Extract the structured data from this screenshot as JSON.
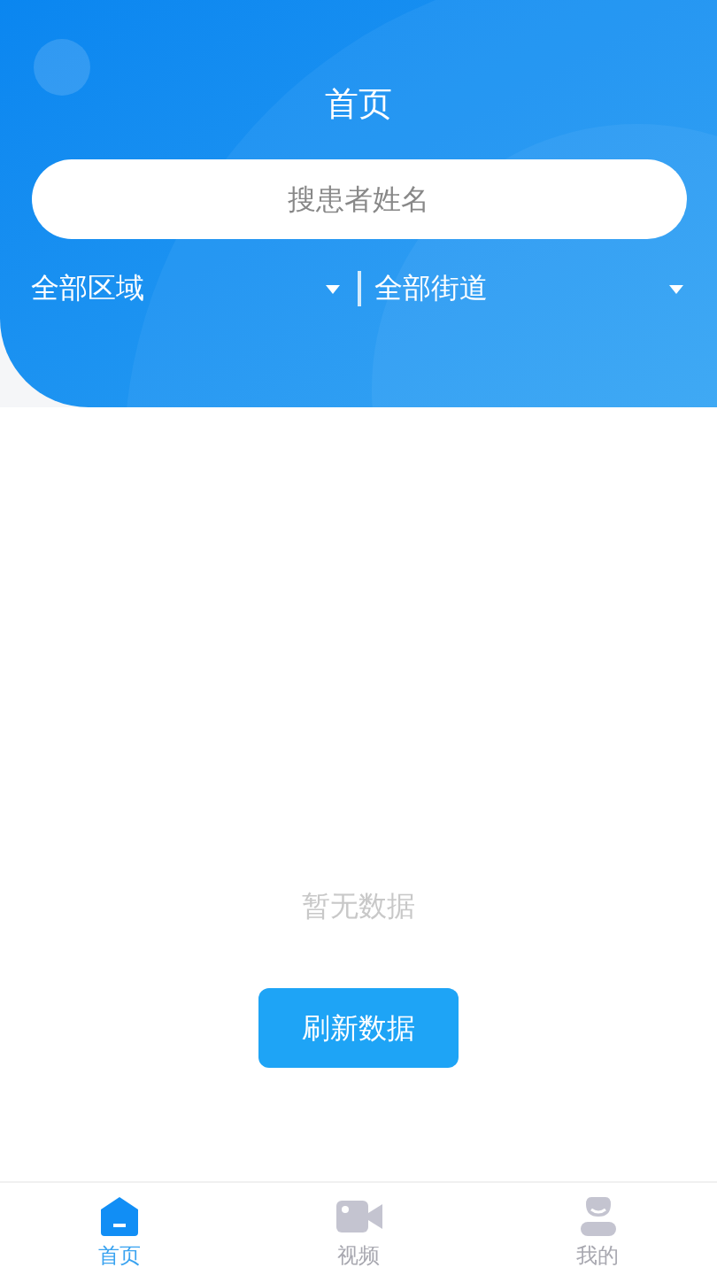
{
  "header": {
    "title": "首页",
    "search": {
      "placeholder": "搜患者姓名"
    },
    "filters": [
      {
        "label": "全部区域"
      },
      {
        "label": "全部街道"
      }
    ]
  },
  "empty": {
    "message": "暂无数据",
    "button": "刷新数据"
  },
  "tabs": [
    {
      "label": "首页",
      "kind": "home",
      "selected": true
    },
    {
      "label": "视频",
      "kind": "video",
      "selected": false
    },
    {
      "label": "我的",
      "kind": "user",
      "selected": false
    }
  ]
}
